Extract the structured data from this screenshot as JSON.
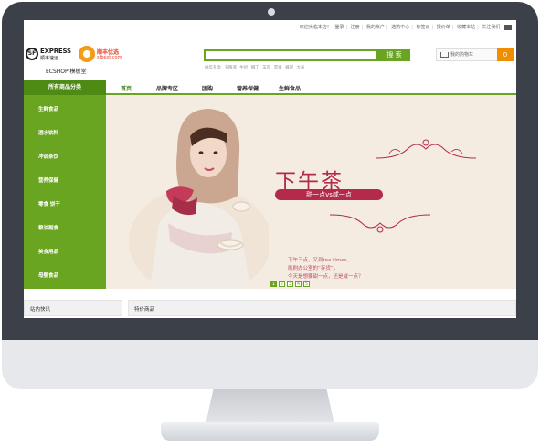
{
  "topbar": {
    "links": [
      "欢迎光临本店！",
      "登录",
      "注册",
      "我的账户",
      "选购中心",
      "标签云",
      "报价单",
      "收藏本站",
      "关注我们"
    ]
  },
  "header": {
    "sf_mark": "SF",
    "sf_express": "EXPRESS",
    "sf_sub": "顺丰速运",
    "sfbest_name": "顺丰优选",
    "sfbest_url": "sfbest.com",
    "edition": "ECSHOP 模板堂"
  },
  "search": {
    "button": "搜 索",
    "hot_keywords": [
      "融年礼盒",
      "五粮液",
      "牛奶",
      "椰丁",
      "羊肉",
      "苹果",
      "蜂蜜",
      "大米"
    ]
  },
  "cart": {
    "label": "我的购物车",
    "count": "0"
  },
  "nav": {
    "category_header": "所有商品分类",
    "items": [
      "首页",
      "品牌专区",
      "团购",
      "营养保健",
      "生鲜食品"
    ]
  },
  "categories": [
    "生鲜食品",
    "酒水饮料",
    "冲调茶饮",
    "营养保健",
    "零食 饼干",
    "粮油副食",
    "美食用品",
    "母婴食品"
  ],
  "banner": {
    "title": "下午茶",
    "ribbon": "甜一点vs咸一点",
    "lines": [
      "下午三点，又到tea times,",
      "刷刷办公室的“存货”，",
      "今天是想要甜一点，还是咸一点？"
    ],
    "pages": [
      "1",
      "2",
      "3",
      "4",
      "5"
    ],
    "active_page": 0
  },
  "bottom": {
    "news_title": "站内快讯",
    "special_title": "特价商品"
  },
  "colors": {
    "brand_green": "#6aa521",
    "dark_green": "#4d8b14",
    "accent_orange": "#f18d00",
    "banner_red": "#b32a4b"
  }
}
